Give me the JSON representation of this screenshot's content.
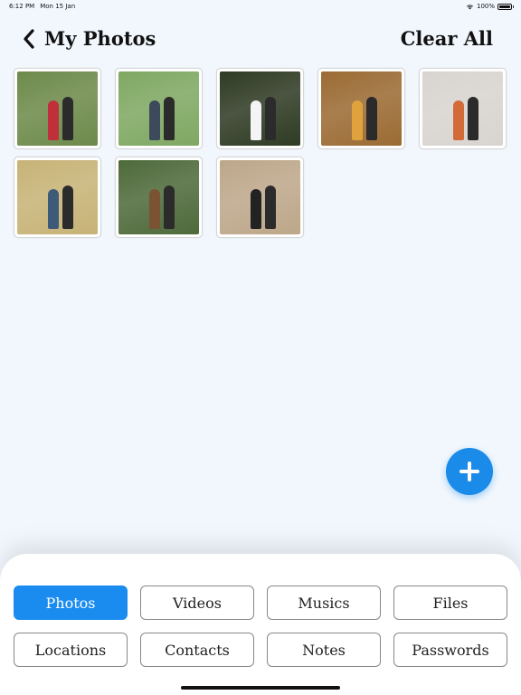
{
  "status_bar": {
    "time": "6:12 PM",
    "date": "Mon 15 Jan",
    "battery": "100%"
  },
  "header": {
    "title": "My Photos",
    "clear_all_label": "Clear All"
  },
  "photos": [
    {
      "name": "photo-1",
      "bg": "#6d8a4a",
      "accent": "#c0303a"
    },
    {
      "name": "photo-2",
      "bg": "#7fa862",
      "accent": "#3c4a5c"
    },
    {
      "name": "photo-3",
      "bg": "#2f3b24",
      "accent": "#f4f4f4"
    },
    {
      "name": "photo-4",
      "bg": "#9b6b33",
      "accent": "#e0a23c"
    },
    {
      "name": "photo-5",
      "bg": "#d8d4cf",
      "accent": "#d26a3a"
    },
    {
      "name": "photo-6",
      "bg": "#c7b377",
      "accent": "#3d5a78"
    },
    {
      "name": "photo-7",
      "bg": "#4e6a3a",
      "accent": "#7a5432"
    },
    {
      "name": "photo-8",
      "bg": "#bda78a",
      "accent": "#222222"
    }
  ],
  "fab": {
    "icon": "plus-icon",
    "color": "#1a8be8"
  },
  "tabs": [
    {
      "label": "Photos",
      "active": true
    },
    {
      "label": "Videos",
      "active": false
    },
    {
      "label": "Musics",
      "active": false
    },
    {
      "label": "Files",
      "active": false
    },
    {
      "label": "Locations",
      "active": false
    },
    {
      "label": "Contacts",
      "active": false
    },
    {
      "label": "Notes",
      "active": false
    },
    {
      "label": "Passwords",
      "active": false
    }
  ],
  "colors": {
    "accent": "#1a8cf0",
    "background": "#f2f7fd"
  }
}
